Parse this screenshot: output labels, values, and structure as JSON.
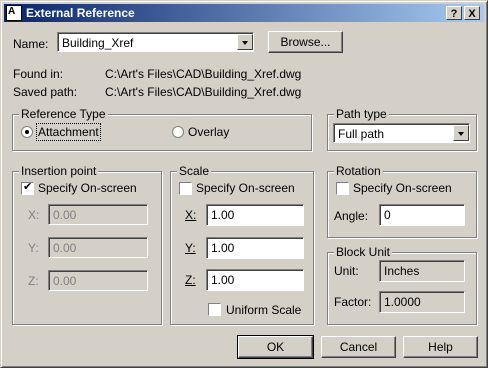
{
  "window": {
    "title": "External Reference",
    "help_btn": "?",
    "close_btn": "X"
  },
  "name": {
    "label": "Name:",
    "value": "Building_Xref",
    "browse_label": "Browse..."
  },
  "found_in": {
    "label": "Found in:",
    "value": "C:\\Art's Files\\CAD\\Building_Xref.dwg"
  },
  "saved_path": {
    "label": "Saved path:",
    "value": "C:\\Art's Files\\CAD\\Building_Xref.dwg"
  },
  "reference_type": {
    "title": "Reference Type",
    "attachment": "Attachment",
    "overlay": "Overlay",
    "selected": "attachment"
  },
  "path_type": {
    "title": "Path type",
    "value": "Full path"
  },
  "insertion_point": {
    "title": "Insertion point",
    "specify": "Specify On-screen",
    "specify_checked": true,
    "x_label": "X:",
    "x_value": "0.00",
    "y_label": "Y:",
    "y_value": "0.00",
    "z_label": "Z:",
    "z_value": "0.00"
  },
  "scale": {
    "title": "Scale",
    "specify": "Specify On-screen",
    "specify_checked": false,
    "x_label": "X:",
    "x_value": "1.00",
    "y_label": "Y:",
    "y_value": "1.00",
    "z_label": "Z:",
    "z_value": "1.00",
    "uniform": "Uniform Scale",
    "uniform_checked": false
  },
  "rotation": {
    "title": "Rotation",
    "specify": "Specify On-screen",
    "specify_checked": false,
    "angle_label": "Angle:",
    "angle_value": "0"
  },
  "block_unit": {
    "title": "Block Unit",
    "unit_label": "Unit:",
    "unit_value": "Inches",
    "factor_label": "Factor:",
    "factor_value": "1.0000"
  },
  "buttons": {
    "ok": "OK",
    "cancel": "Cancel",
    "help": "Help"
  }
}
